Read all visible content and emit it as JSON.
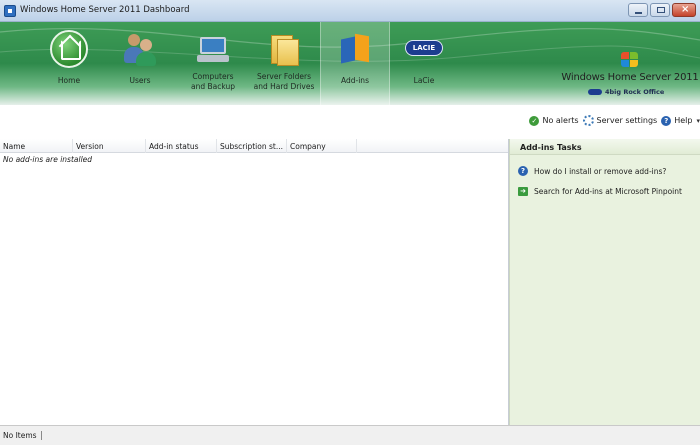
{
  "window": {
    "title": "Windows Home Server 2011 Dashboard"
  },
  "nav": {
    "items": [
      {
        "label": "Home",
        "icon": "home-icon"
      },
      {
        "label": "Users",
        "icon": "users-icon"
      },
      {
        "label": "Computers\nand Backup",
        "icon": "computer-icon"
      },
      {
        "label": "Server Folders\nand Hard Drives",
        "icon": "folders-icon"
      },
      {
        "label": "Add-ins",
        "icon": "addins-icon",
        "active": true
      },
      {
        "label": "LaCie",
        "icon": "lacie-icon"
      }
    ],
    "lacie_badge": "LACIE"
  },
  "brand": {
    "title": "Windows Home Server 2011",
    "server_name": "4big Rock Office"
  },
  "status": {
    "alerts": "No alerts",
    "server_settings": "Server settings",
    "help": "Help"
  },
  "grid": {
    "columns": [
      "Name",
      "Version",
      "Add-in status",
      "Subscription st...",
      "Company"
    ],
    "empty_message": "No add-ins are installed"
  },
  "tasks": {
    "title": "Add-ins Tasks",
    "items": [
      {
        "label": "How do I install or remove add-ins?",
        "icon": "help-icon"
      },
      {
        "label": "Search for Add-ins at Microsoft Pinpoint",
        "icon": "arrow-icon"
      }
    ]
  },
  "statusbar": {
    "items_text": "No Items"
  },
  "colors": {
    "ribbon_green": "#2e8a4b",
    "tasks_background": "#e9f2df",
    "accent_blue": "#2a62b0"
  }
}
